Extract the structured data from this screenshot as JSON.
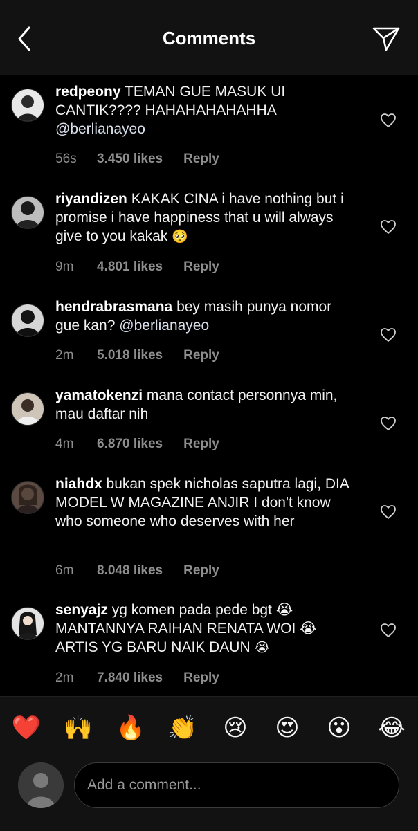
{
  "header": {
    "title": "Comments",
    "back_icon": "chevron-left-icon",
    "send_icon": "paper-plane-icon"
  },
  "comments": [
    {
      "username": "redpeony",
      "text": "TEMAN GUE MASUK UI CANTIK???? HAHAHAHAHAHHA",
      "mention": "@berlianayeo",
      "emoji": "",
      "time": "56s",
      "likes": "3.450 likes",
      "reply": "Reply",
      "avatar_color": "#6b6b6b"
    },
    {
      "username": "riyandizen",
      "text": "KAKAK CINA i have nothing but i promise i have happiness that u will always give to you kakak",
      "mention": "",
      "emoji": "🥺",
      "time": "9m",
      "likes": "4.801 likes",
      "reply": "Reply",
      "avatar_color": "#3b3b3b"
    },
    {
      "username": "hendrabrasmana",
      "text": "bey masih punya nomor gue kan?",
      "mention": "@berlianayeo",
      "emoji": "",
      "time": "2m",
      "likes": "5.018 likes",
      "reply": "Reply",
      "avatar_color": "#2e2e2e"
    },
    {
      "username": "yamatokenzi",
      "text": "mana contact personnya min, mau daftar nih",
      "mention": "",
      "emoji": "",
      "time": "4m",
      "likes": "6.870 likes",
      "reply": "Reply",
      "avatar_color": "#8a7a6a"
    },
    {
      "username": "niahdx",
      "text": "bukan spek nicholas saputra lagi, DIA MODEL W MAGAZINE ANJIR I don't know who someone who deserves with her",
      "mention": "",
      "emoji": "",
      "time": "6m",
      "likes": "8.048 likes",
      "reply": "Reply",
      "avatar_color": "#4a3c36"
    },
    {
      "username": "senyajz",
      "text": "yg komen pada pede bgt 😭 MANTANNYA RAIHAN RENATA WOI 😭 ARTIS YG BARU NAIK DAUN",
      "mention": "",
      "emoji": "😭",
      "time": "2m",
      "likes": "7.840 likes",
      "reply": "Reply",
      "avatar_color": "#d0d0d0"
    }
  ],
  "quick_reactions": [
    {
      "emoji": "❤️",
      "icon": "red-heart-emoji"
    },
    {
      "emoji": "🙌",
      "icon": "raising-hands-emoji"
    },
    {
      "emoji": "🔥",
      "icon": "fire-emoji"
    },
    {
      "emoji": "👏",
      "icon": "clapping-hands-emoji"
    },
    {
      "emoji": "😢",
      "icon": "crying-face-emoji"
    },
    {
      "emoji": "😍",
      "icon": "heart-eyes-emoji"
    },
    {
      "emoji": "😮",
      "icon": "surprised-face-emoji"
    },
    {
      "emoji": "😂",
      "icon": "tears-of-joy-emoji"
    }
  ],
  "composer": {
    "placeholder": "Add a comment..."
  },
  "colors": {
    "background": "#000000",
    "header_background": "#121212",
    "meta_text": "#8e8e8e"
  }
}
